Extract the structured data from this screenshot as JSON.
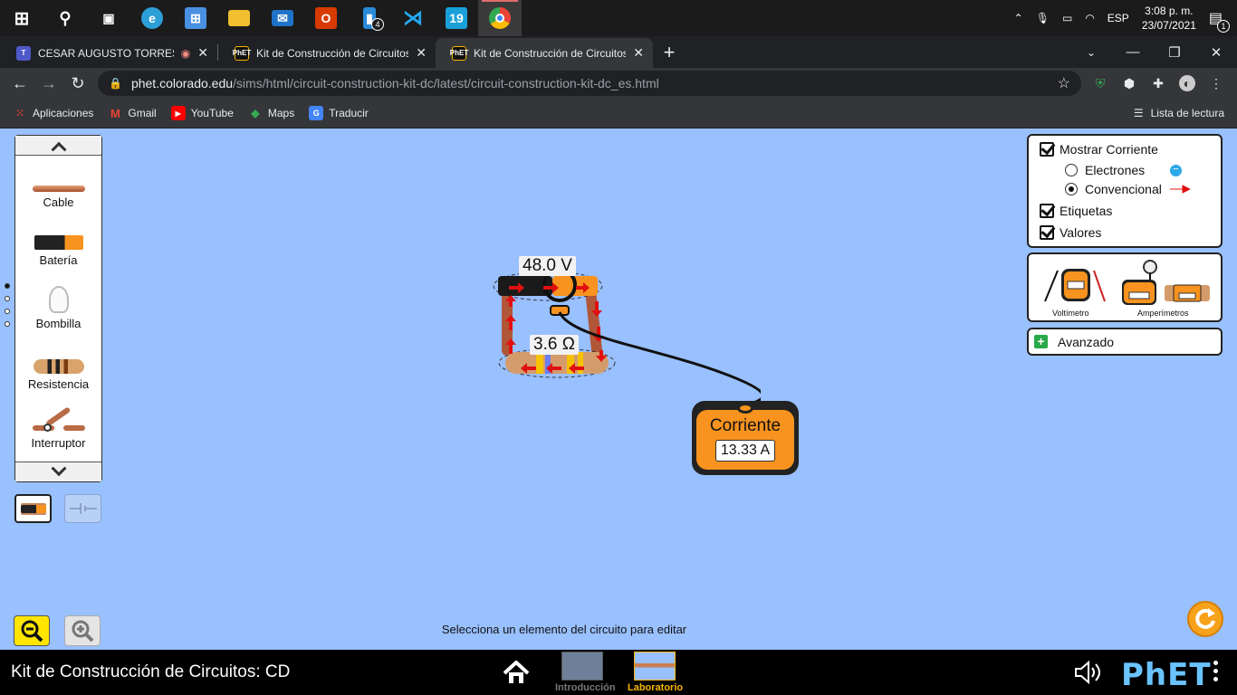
{
  "taskbar": {
    "apps": [
      {
        "name": "start",
        "glyph": "⊞",
        "color": "#ffffff"
      },
      {
        "name": "search",
        "glyph": "⚲",
        "color": "#ffffff"
      },
      {
        "name": "task-view",
        "glyph": "▣",
        "color": "#ffffff"
      },
      {
        "name": "edge",
        "glyph": "e",
        "color": "#2d9fd8"
      },
      {
        "name": "store",
        "glyph": "⊞",
        "color": "#4a90e2"
      },
      {
        "name": "file-explorer",
        "glyph": "▬",
        "color": "#f0c030"
      },
      {
        "name": "mail",
        "glyph": "✉",
        "color": "#1e73c8"
      },
      {
        "name": "office",
        "glyph": "O",
        "color": "#d83b01"
      },
      {
        "name": "phone",
        "glyph": "▮",
        "color": "#2a8ad8"
      },
      {
        "name": "vscode",
        "glyph": "⋊",
        "color": "#23a9f2"
      },
      {
        "name": "app-19",
        "glyph": "19",
        "color": "#1aa0d8"
      },
      {
        "name": "chrome",
        "glyph": "◉",
        "color": "#34a853"
      }
    ],
    "phone_badge": "4",
    "lang": "ESP",
    "time": "3:08 p. m.",
    "date": "23/07/2021",
    "notif_count": "1"
  },
  "browser": {
    "tabs": [
      {
        "title": "CESAR AUGUSTO TORRES OI",
        "favicon": "T",
        "favicon_color": "#5059c9"
      },
      {
        "title": "Kit de Construcción de Circuitos:",
        "favicon": "PhET",
        "favicon_color": "#111111"
      },
      {
        "title": "Kit de Construcción de Circuitos:",
        "favicon": "PhET",
        "favicon_color": "#111111"
      }
    ],
    "url_host": "phet.colorado.edu",
    "url_path": "/sims/html/circuit-construction-kit-dc/latest/circuit-construction-kit-dc_es.html",
    "bookmarks": [
      {
        "label": "Aplicaciones",
        "icon": "⋮⋮",
        "color": "#e94235"
      },
      {
        "label": "Gmail",
        "icon": "M",
        "color": "#ea4335"
      },
      {
        "label": "YouTube",
        "icon": "▶",
        "color": "#ff0000"
      },
      {
        "label": "Maps",
        "icon": "◆",
        "color": "#34a853"
      },
      {
        "label": "Traducir",
        "icon": "G",
        "color": "#4285f4"
      }
    ],
    "reading_list": "Lista de lectura"
  },
  "toolbox": {
    "items": [
      {
        "label": "Cable"
      },
      {
        "label": "Batería"
      },
      {
        "label": "Bombilla"
      },
      {
        "label": "Resistencia"
      },
      {
        "label": "Interruptor"
      }
    ]
  },
  "controls": {
    "show_current": "Mostrar Corriente",
    "electrons": "Electrones",
    "conventional": "Convencional",
    "labels": "Etiquetas",
    "values": "Valores",
    "voltmeter": "Voltímetro",
    "ammeters": "Amperímetros",
    "advanced": "Avanzado"
  },
  "circuit": {
    "battery_voltage": "48.0 V",
    "resistance": "3.6 Ω"
  },
  "ammeter": {
    "caption": "Corriente",
    "reading": "13.33 A"
  },
  "status_message": "Selecciona un elemento del circuito para editar",
  "phet_bar": {
    "sim_title": "Kit de Construcción de Circuitos: CD",
    "screens": [
      {
        "label": "Introducción"
      },
      {
        "label": "Laboratorio"
      }
    ],
    "logo": "PhET"
  }
}
